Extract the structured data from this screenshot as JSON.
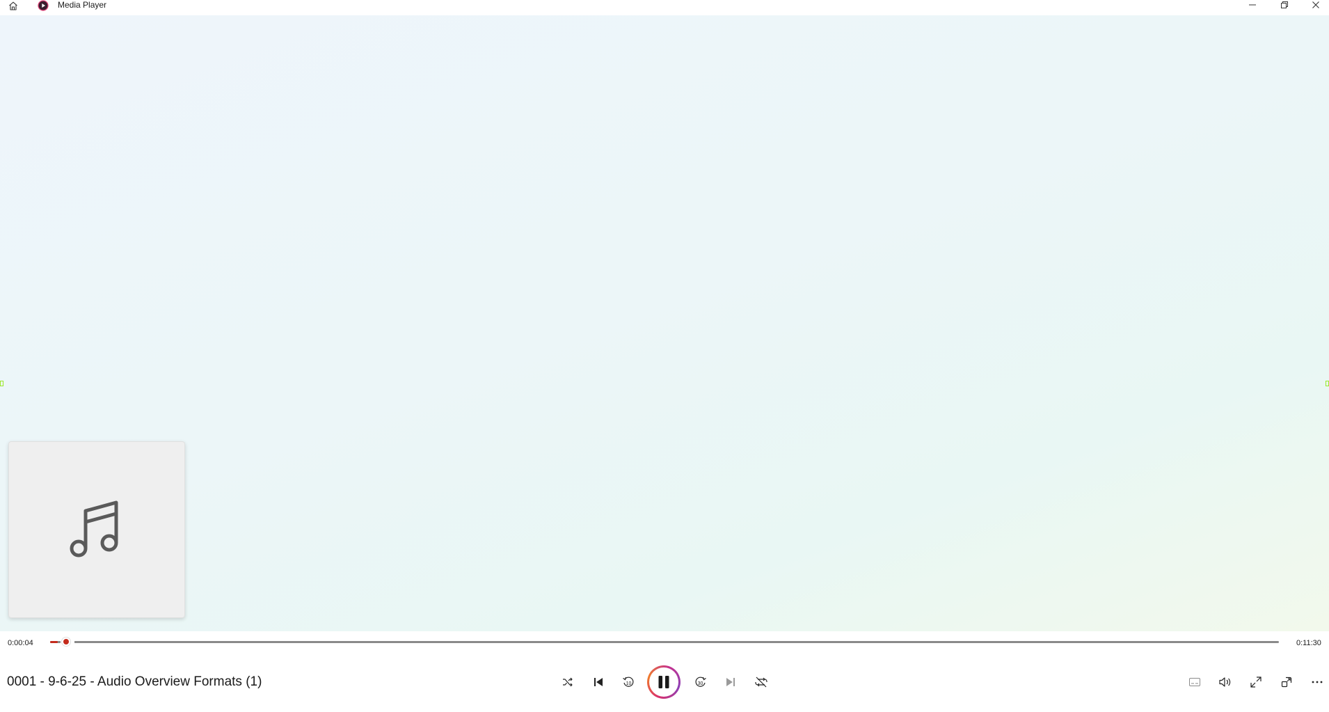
{
  "window": {
    "title": "Media Player",
    "icons": {
      "home": "home-icon",
      "logo": "media-player-logo-icon",
      "minimize": "minimize-icon",
      "maximize": "restore-icon",
      "close": "close-icon"
    }
  },
  "player": {
    "current_time": "0:00:04",
    "total_time": "0:11:30",
    "progress": 0.006,
    "track_title": "0001 - 9-6-25 - Audio Overview Formats (1)",
    "accent_color": "#c42b1c",
    "album_art_icon": "music-note-icon"
  },
  "controls": {
    "shuffle": "shuffle-icon",
    "previous": "previous-icon",
    "rewind": "rewind-10-icon",
    "rewind_label": "10",
    "play_pause": "pause-icon",
    "forward": "forward-30-icon",
    "forward_label": "30",
    "next": "next-icon",
    "repeat": "repeat-icon",
    "captions": "captions-icon",
    "volume": "volume-icon",
    "fullscreen": "fullscreen-icon",
    "miniplayer": "miniplayer-icon",
    "more": "more-options-icon"
  }
}
